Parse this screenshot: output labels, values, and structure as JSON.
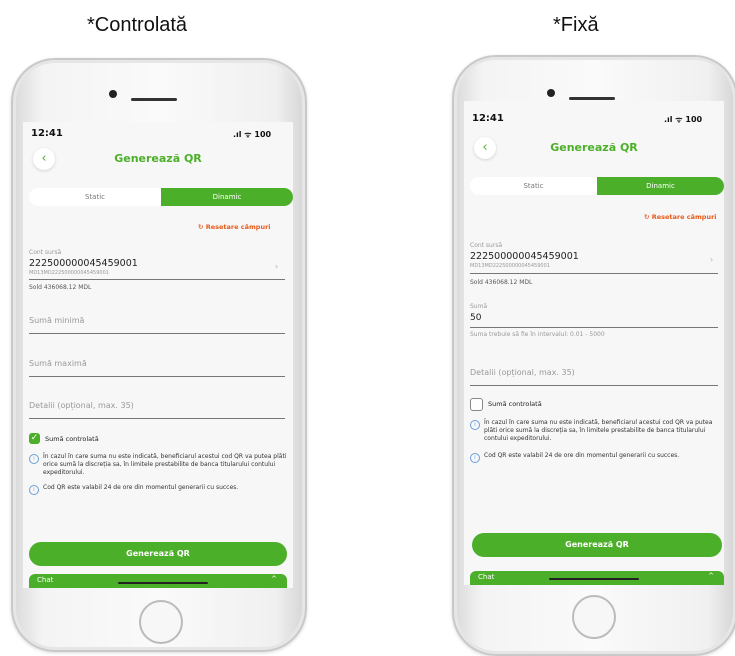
{
  "captions": {
    "left": "*Controlată",
    "right": "*Fixă"
  },
  "accent_color": "#4caf2a",
  "reset_color": "#e85a1c",
  "phones": [
    {
      "time": "12:41",
      "system_icons": ".ıl ᯤ 100",
      "back_symbol": "‹",
      "title": "Generează QR",
      "tabs": [
        "Static",
        "Dinamic"
      ],
      "active_tab": "Dinamic",
      "reset_label": "Resetare câmpuri",
      "reset_icon": "refresh-icon",
      "account_label": "Cont sursă",
      "account_number": "222500000045459001",
      "account_iban": "MD13MD222500000045459001",
      "balance": "Sold 436068.12 MDL",
      "min_placeholder": "Sumă minimă",
      "max_placeholder": "Sumă maximă",
      "details_placeholder": "Detalii (opțional, max. 35)",
      "checkbox_label": "Sumă controlată",
      "checkbox_checked": true,
      "info_1": "În cazul în care suma nu este indicată, beneficiarul acestui cod QR va putea plăti orice sumă la discreția sa, în limitele prestabilite de banca titularului contului expeditorului.",
      "info_2": "Cod QR este valabil 24 de ore din momentul generarii cu succes.",
      "generate_label": "Generează QR",
      "chat_label": "Chat",
      "chat_caret": "^"
    },
    {
      "time": "12:41",
      "system_icons": ".ıl ᯤ 100",
      "back_symbol": "‹",
      "title": "Generează QR",
      "tabs": [
        "Static",
        "Dinamic"
      ],
      "active_tab": "Dinamic",
      "reset_label": "Resetare câmpuri",
      "reset_icon": "refresh-icon",
      "account_label": "Cont sursă",
      "account_number": "222500000045459001",
      "account_iban": "MD13MD222500000045459001",
      "balance": "Sold 436068.12 MDL",
      "sum_label": "Sumă",
      "sum_value": "50",
      "sum_hint": "Suma trebuie să fie în intervalul: 0.01 - 5000",
      "details_placeholder": "Detalii (opțional, max. 35)",
      "checkbox_label": "Sumă controlată",
      "checkbox_checked": false,
      "info_1": "În cazul în care suma nu este indicată, beneficiarul acestui cod QR va putea plăti orice sumă la discreția sa, în limitele prestabilite de banca titularului contului expeditorului.",
      "info_2": "Cod QR este valabil 24 de ore din momentul generarii cu succes.",
      "generate_label": "Generează QR",
      "chat_label": "Chat",
      "chat_caret": "^"
    }
  ]
}
